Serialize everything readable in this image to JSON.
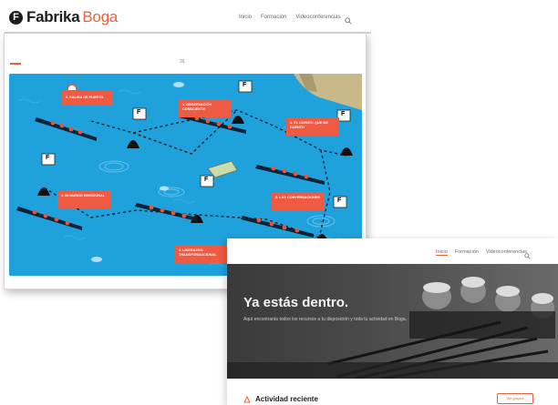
{
  "brand": {
    "mark_letter": "F",
    "word": "Fabrika",
    "accent_word": "Boga",
    "accent_color": "#e8603c"
  },
  "top_nav": {
    "items": [
      "Inicio",
      "Formación",
      "Videoconferencias"
    ]
  },
  "back_card": {
    "page_number": "3/L",
    "map": {
      "sea_color": "#1fa1dc",
      "labels": [
        "0. SALIDA DE PUERTO",
        "1. OBSERVACIÓN CONSCIENTE",
        "2. EL CUENTO QUE ME CUENTO",
        "3. MI MUNDO EMOCIONAL",
        "4. LIDERAZGO TRANSFORMACIONAL",
        "5. LAS CONVERSACIONES"
      ],
      "flag_letter": "F"
    }
  },
  "front_card": {
    "nav": [
      "Inicio",
      "Formación",
      "Videoconferencias"
    ],
    "hero": {
      "title": "Ya estás dentro.",
      "subtitle": "Aquí encontrarás todos los recursos a tu disposición y toda tu actividad en Boga."
    },
    "activity": {
      "title": "Actividad reciente",
      "button_label": "Ver grupos"
    }
  }
}
